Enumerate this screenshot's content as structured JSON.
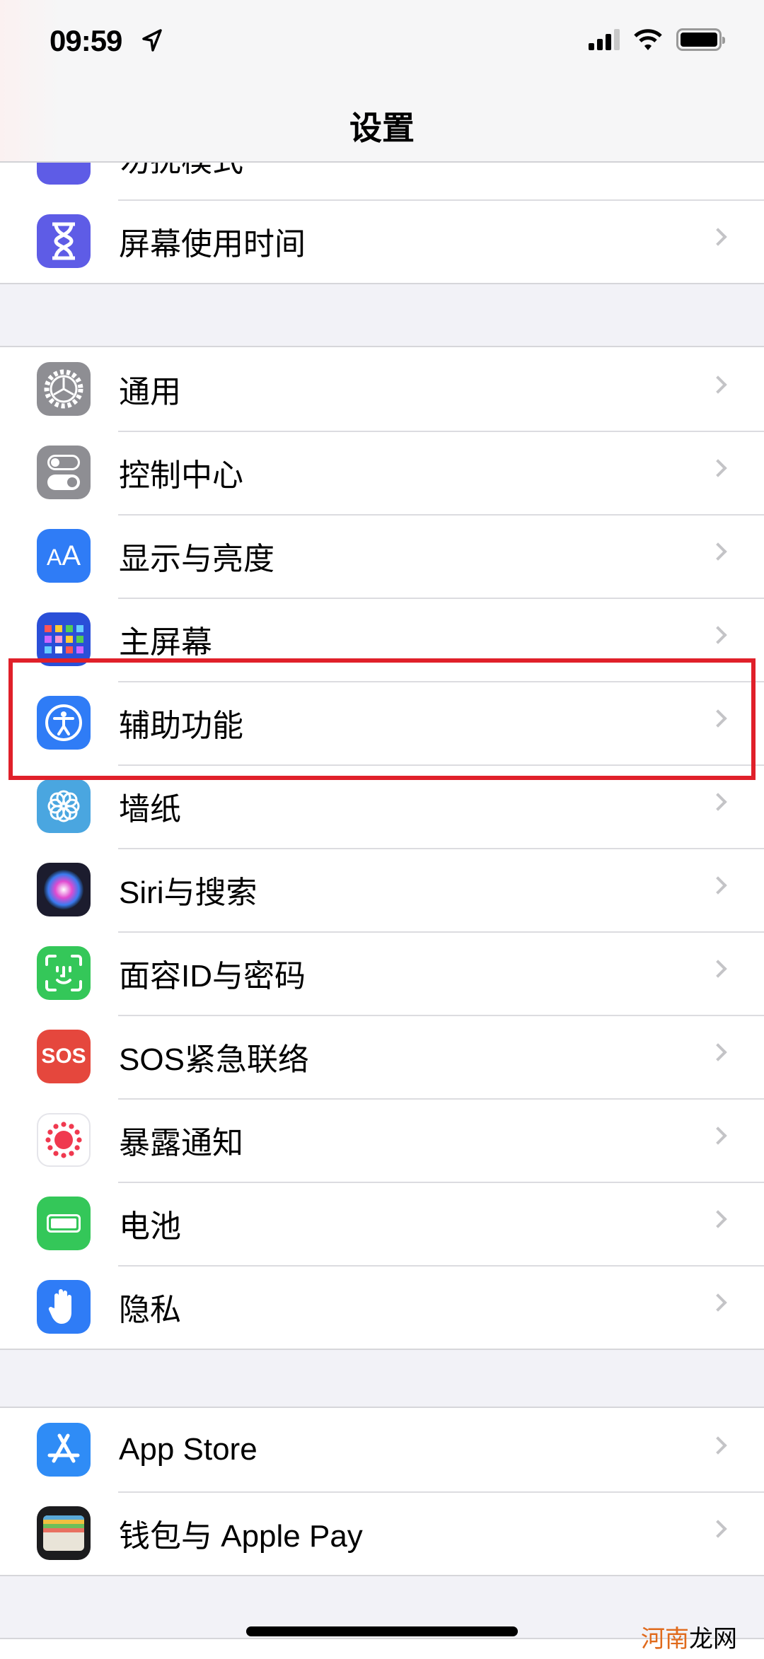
{
  "status_bar": {
    "time": "09:59",
    "location_icon": "location-arrow-icon",
    "signal_icon": "cellular-signal-icon",
    "wifi_icon": "wifi-icon",
    "battery_icon": "battery-icon"
  },
  "header": {
    "title": "设置"
  },
  "sections": [
    {
      "items": [
        {
          "label": "勿扰模式",
          "icon": "moon-icon",
          "color": "#5e5ce6"
        },
        {
          "label": "屏幕使用时间",
          "icon": "hourglass-icon",
          "color": "#5e5ce6"
        }
      ]
    },
    {
      "items": [
        {
          "label": "通用",
          "icon": "gear-icon",
          "color": "#8e8e93"
        },
        {
          "label": "控制中心",
          "icon": "toggles-icon",
          "color": "#8e8e93"
        },
        {
          "label": "显示与亮度",
          "icon": "text-size-icon",
          "color": "#2f7cf6"
        },
        {
          "label": "主屏幕",
          "icon": "home-grid-icon",
          "color": "#2a4fd8"
        },
        {
          "label": "辅助功能",
          "icon": "accessibility-icon",
          "color": "#2f7cf6",
          "highlighted": true
        },
        {
          "label": "墙纸",
          "icon": "flower-icon",
          "color": "#4aa6e0"
        },
        {
          "label": "Siri与搜索",
          "icon": "siri-icon",
          "color": "#1c1c2e"
        },
        {
          "label": "面容ID与密码",
          "icon": "face-id-icon",
          "color": "#34c759"
        },
        {
          "label": "SOS紧急联络",
          "icon": "sos-icon",
          "color": "#e5473d",
          "icon_text": "SOS"
        },
        {
          "label": "暴露通知",
          "icon": "exposure-icon",
          "color": "#ffffff"
        },
        {
          "label": "电池",
          "icon": "battery-icon",
          "color": "#34c759"
        },
        {
          "label": "隐私",
          "icon": "hand-icon",
          "color": "#2f7cf6"
        }
      ]
    },
    {
      "items": [
        {
          "label": "App Store",
          "icon": "app-store-icon",
          "color": "#2f8cf6"
        },
        {
          "label": "钱包与 Apple Pay",
          "icon": "wallet-icon",
          "color": "#1c1c1e"
        }
      ]
    }
  ],
  "highlight_color": "#e0202a",
  "watermark": {
    "part1": "河南",
    "part2": "龙网"
  }
}
